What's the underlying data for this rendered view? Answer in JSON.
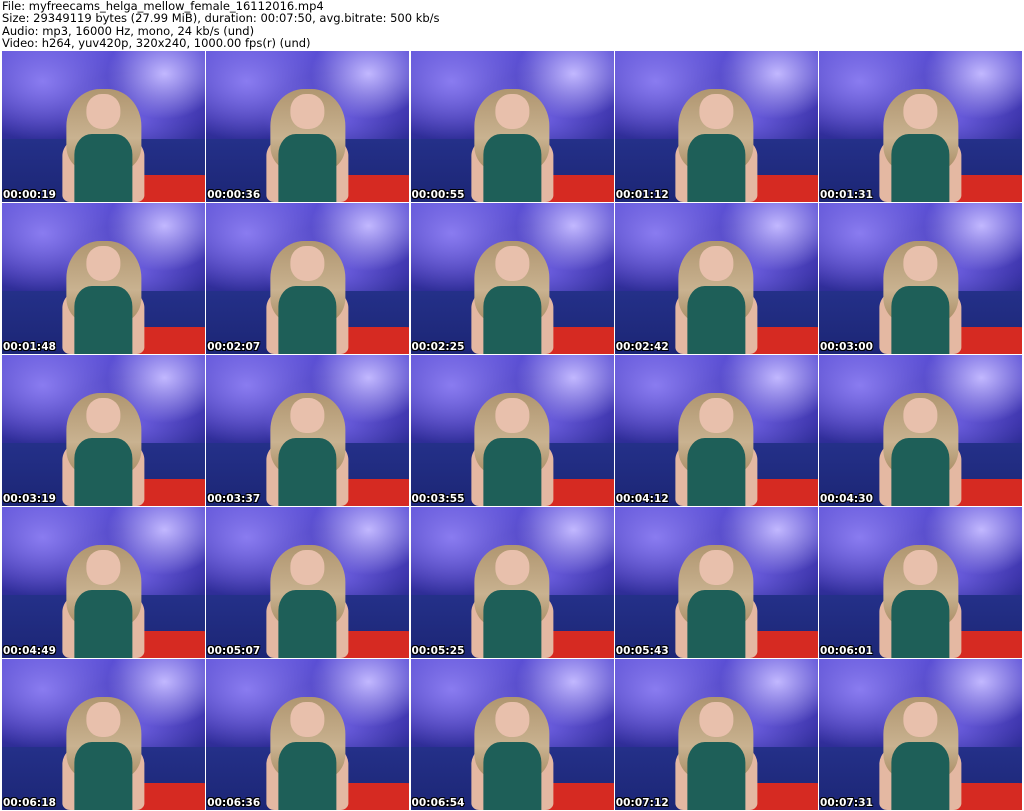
{
  "header": {
    "file_line": "File: myfreecams_helga_mellow_female_16112016.mp4",
    "size_line": "Size: 29349119 bytes (27.99 MiB), duration: 00:07:50, avg.bitrate: 500 kb/s",
    "audio_line": "Audio: mp3, 16000 Hz, mono, 24 kb/s (und)",
    "video_line": "Video: h264, yuv420p, 320x240, 1000.00 fps(r) (und)"
  },
  "thumbnails": [
    {
      "timestamp": "00:00:19"
    },
    {
      "timestamp": "00:00:36"
    },
    {
      "timestamp": "00:00:55"
    },
    {
      "timestamp": "00:01:12"
    },
    {
      "timestamp": "00:01:31"
    },
    {
      "timestamp": "00:01:48"
    },
    {
      "timestamp": "00:02:07"
    },
    {
      "timestamp": "00:02:25"
    },
    {
      "timestamp": "00:02:42"
    },
    {
      "timestamp": "00:03:00"
    },
    {
      "timestamp": "00:03:19"
    },
    {
      "timestamp": "00:03:37"
    },
    {
      "timestamp": "00:03:55"
    },
    {
      "timestamp": "00:04:12"
    },
    {
      "timestamp": "00:04:30"
    },
    {
      "timestamp": "00:04:49"
    },
    {
      "timestamp": "00:05:07"
    },
    {
      "timestamp": "00:05:25"
    },
    {
      "timestamp": "00:05:43"
    },
    {
      "timestamp": "00:06:01"
    },
    {
      "timestamp": "00:06:18"
    },
    {
      "timestamp": "00:06:36"
    },
    {
      "timestamp": "00:06:54"
    },
    {
      "timestamp": "00:07:12"
    },
    {
      "timestamp": "00:07:31"
    }
  ],
  "colors": {
    "background": "#ffffff",
    "backdrop_purple": "#5b4fd6",
    "couch_blue": "#243089",
    "blanket_red": "#d62a22",
    "top_green": "#1e5f58",
    "timestamp_text": "#ffffff"
  }
}
